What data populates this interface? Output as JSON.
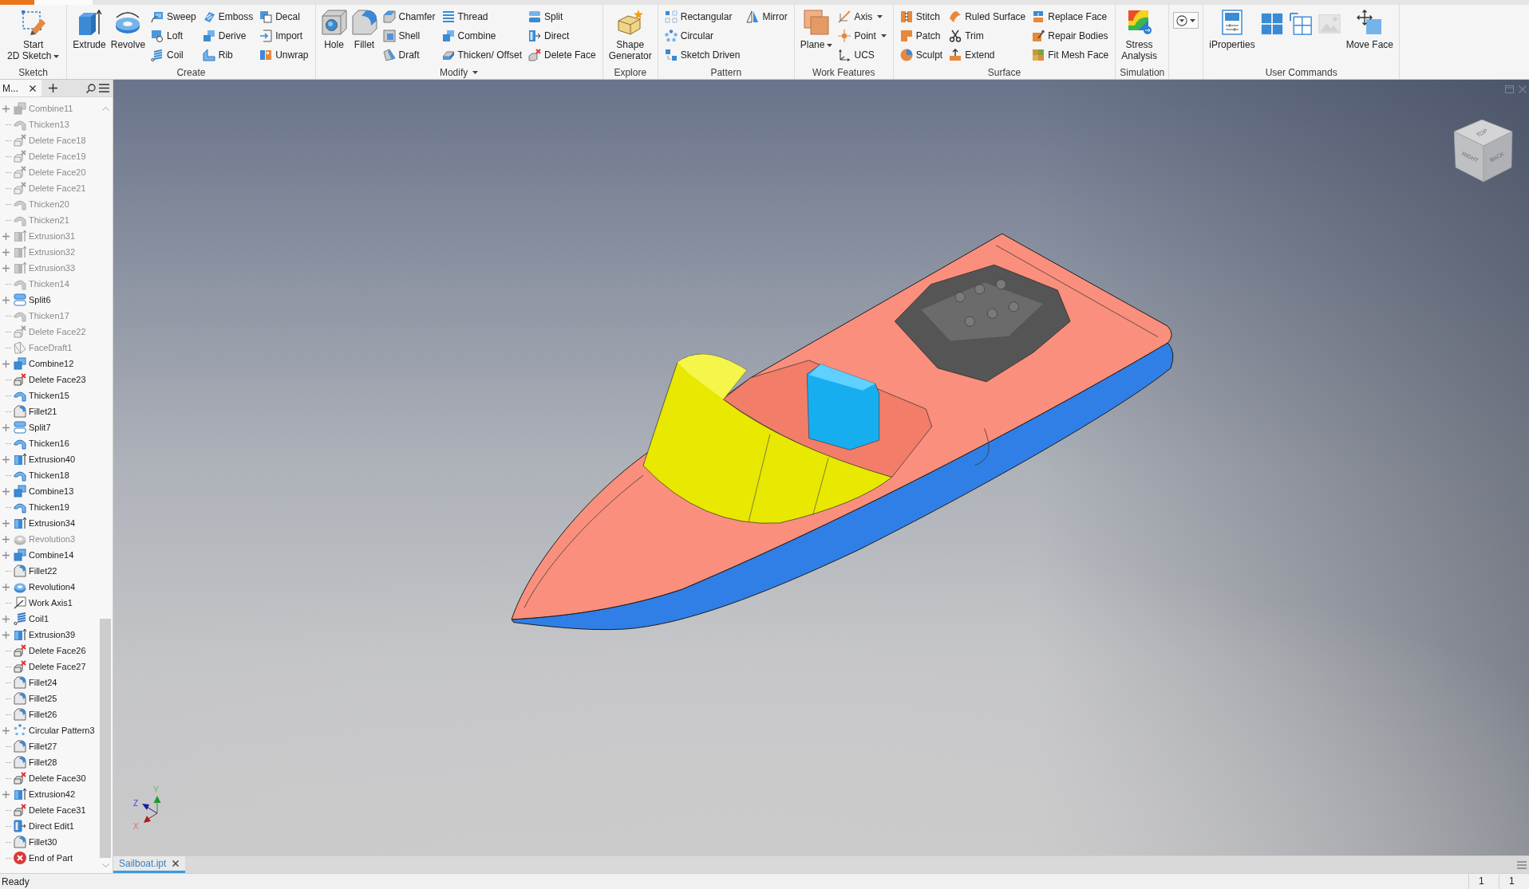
{
  "ribbon": {
    "groups": [
      {
        "label": "Sketch",
        "menu": false,
        "columns": [
          [
            {
              "label": "Start\n2D Sketch",
              "kind": "large",
              "dropdown": true
            }
          ]
        ]
      },
      {
        "label": "Create",
        "menu": false,
        "columns": [
          [
            {
              "label": "Extrude",
              "kind": "large",
              "dropdown": false
            }
          ],
          [
            {
              "label": "Revolve",
              "kind": "large",
              "dropdown": false
            }
          ],
          [
            {
              "label": "Sweep",
              "kind": "small",
              "dropdown": false
            },
            {
              "label": "Loft",
              "kind": "small",
              "dropdown": false
            },
            {
              "label": "Coil",
              "kind": "small",
              "dropdown": false
            }
          ],
          [
            {
              "label": "Emboss",
              "kind": "small",
              "dropdown": false
            },
            {
              "label": "Derive",
              "kind": "small",
              "dropdown": false
            },
            {
              "label": "Rib",
              "kind": "small",
              "dropdown": false
            }
          ],
          [
            {
              "label": "Decal",
              "kind": "small",
              "dropdown": false
            },
            {
              "label": "Import",
              "kind": "small",
              "dropdown": false
            },
            {
              "label": "Unwrap",
              "kind": "small",
              "dropdown": false
            }
          ]
        ]
      },
      {
        "label": "Modify",
        "menu": true,
        "columns": [
          [
            {
              "label": "Hole",
              "kind": "large",
              "dropdown": false
            }
          ],
          [
            {
              "label": "Fillet",
              "kind": "large",
              "dropdown": false
            }
          ],
          [
            {
              "label": "Chamfer",
              "kind": "small",
              "dropdown": false
            },
            {
              "label": "Shell",
              "kind": "small",
              "dropdown": false
            },
            {
              "label": "Draft",
              "kind": "small",
              "dropdown": false
            }
          ],
          [
            {
              "label": "Thread",
              "kind": "small",
              "dropdown": false
            },
            {
              "label": "Combine",
              "kind": "small",
              "dropdown": false
            },
            {
              "label": "Thicken/ Offset",
              "kind": "small",
              "dropdown": false
            }
          ],
          [
            {
              "label": "Split",
              "kind": "small",
              "dropdown": false
            },
            {
              "label": "Direct",
              "kind": "small",
              "dropdown": false
            },
            {
              "label": "Delete Face",
              "kind": "small",
              "dropdown": false
            }
          ]
        ]
      },
      {
        "label": "Explore",
        "menu": false,
        "columns": [
          [
            {
              "label": "Shape\nGenerator",
              "kind": "large",
              "dropdown": false
            }
          ]
        ]
      },
      {
        "label": "Pattern",
        "menu": false,
        "columns": [
          [
            {
              "label": "Rectangular",
              "kind": "small",
              "dropdown": false
            },
            {
              "label": "Circular",
              "kind": "small",
              "dropdown": false
            },
            {
              "label": "Sketch Driven",
              "kind": "small",
              "dropdown": false
            }
          ],
          [
            {
              "label": "Mirror",
              "kind": "small",
              "dropdown": false
            }
          ]
        ]
      },
      {
        "label": "Work Features",
        "menu": false,
        "columns": [
          [
            {
              "label": "Plane",
              "kind": "large",
              "dropdown": true
            }
          ],
          [
            {
              "label": "Axis",
              "kind": "small",
              "dropdown": true
            },
            {
              "label": "Point",
              "kind": "small",
              "dropdown": true
            },
            {
              "label": "UCS",
              "kind": "small",
              "dropdown": false
            }
          ]
        ]
      },
      {
        "label": "Surface",
        "menu": false,
        "columns": [
          [
            {
              "label": "Stitch",
              "kind": "small",
              "dropdown": false
            },
            {
              "label": "Patch",
              "kind": "small",
              "dropdown": false
            },
            {
              "label": "Sculpt",
              "kind": "small",
              "dropdown": false
            }
          ],
          [
            {
              "label": "Ruled Surface",
              "kind": "small",
              "dropdown": false
            },
            {
              "label": "Trim",
              "kind": "small",
              "dropdown": false
            },
            {
              "label": "Extend",
              "kind": "small",
              "dropdown": false
            }
          ],
          [
            {
              "label": "Replace Face",
              "kind": "small",
              "dropdown": false
            },
            {
              "label": "Repair Bodies",
              "kind": "small",
              "dropdown": false
            },
            {
              "label": "Fit Mesh Face",
              "kind": "small",
              "dropdown": false
            }
          ]
        ]
      },
      {
        "label": "Simulation",
        "menu": false,
        "columns": [
          [
            {
              "label": "Stress\nAnalysis",
              "kind": "large",
              "dropdown": false
            }
          ]
        ]
      },
      {
        "columns": [
          [
            {
              "kind": "menu",
              "dropdown": true
            }
          ]
        ]
      },
      {
        "label": "User Commands",
        "menu": false,
        "columns": [
          [
            {
              "label": "iProperties",
              "kind": "large",
              "dropdown": false
            }
          ],
          [
            {
              "kind": "icon",
              "dropdown": false
            }
          ],
          [
            {
              "kind": "icon",
              "dropdown": false
            }
          ],
          [
            {
              "kind": "icon",
              "dropdown": false
            }
          ],
          [
            {
              "label": "Move Face",
              "kind": "large",
              "dropdown": false
            }
          ]
        ]
      }
    ]
  },
  "browser": {
    "tab": "M...",
    "items": [
      {
        "label": "Combine11",
        "kind": "combine",
        "expandable": true,
        "dimmed": true
      },
      {
        "label": "Thicken13",
        "kind": "thicken",
        "expandable": false,
        "dimmed": true
      },
      {
        "label": "Delete Face18",
        "kind": "delete-face",
        "expandable": false,
        "dimmed": true
      },
      {
        "label": "Delete Face19",
        "kind": "delete-face",
        "expandable": false,
        "dimmed": true
      },
      {
        "label": "Delete Face20",
        "kind": "delete-face",
        "expandable": false,
        "dimmed": true
      },
      {
        "label": "Delete Face21",
        "kind": "delete-face",
        "expandable": false,
        "dimmed": true
      },
      {
        "label": "Thicken20",
        "kind": "thicken",
        "expandable": false,
        "dimmed": true
      },
      {
        "label": "Thicken21",
        "kind": "thicken",
        "expandable": false,
        "dimmed": true
      },
      {
        "label": "Extrusion31",
        "kind": "extrusion",
        "expandable": true,
        "dimmed": true
      },
      {
        "label": "Extrusion32",
        "kind": "extrusion",
        "expandable": true,
        "dimmed": true
      },
      {
        "label": "Extrusion33",
        "kind": "extrusion",
        "expandable": true,
        "dimmed": true
      },
      {
        "label": "Thicken14",
        "kind": "thicken",
        "expandable": false,
        "dimmed": true
      },
      {
        "label": "Split6",
        "kind": "split",
        "expandable": true,
        "dimmed": false
      },
      {
        "label": "Thicken17",
        "kind": "thicken",
        "expandable": false,
        "dimmed": true
      },
      {
        "label": "Delete Face22",
        "kind": "delete-face",
        "expandable": false,
        "dimmed": true
      },
      {
        "label": "FaceDraft1",
        "kind": "face-draft",
        "expandable": false,
        "dimmed": true
      },
      {
        "label": "Combine12",
        "kind": "combine",
        "expandable": true,
        "dimmed": false
      },
      {
        "label": "Delete Face23",
        "kind": "delete-face",
        "expandable": false,
        "dimmed": false
      },
      {
        "label": "Thicken15",
        "kind": "thicken",
        "expandable": false,
        "dimmed": false
      },
      {
        "label": "Fillet21",
        "kind": "fillet",
        "expandable": false,
        "dimmed": false
      },
      {
        "label": "Split7",
        "kind": "split",
        "expandable": true,
        "dimmed": false
      },
      {
        "label": "Thicken16",
        "kind": "thicken",
        "expandable": false,
        "dimmed": false
      },
      {
        "label": "Extrusion40",
        "kind": "extrusion",
        "expandable": true,
        "dimmed": false
      },
      {
        "label": "Thicken18",
        "kind": "thicken",
        "expandable": false,
        "dimmed": false
      },
      {
        "label": "Combine13",
        "kind": "combine",
        "expandable": true,
        "dimmed": false
      },
      {
        "label": "Thicken19",
        "kind": "thicken",
        "expandable": false,
        "dimmed": false
      },
      {
        "label": "Extrusion34",
        "kind": "extrusion",
        "expandable": true,
        "dimmed": false
      },
      {
        "label": "Revolution3",
        "kind": "revolution",
        "expandable": true,
        "dimmed": true
      },
      {
        "label": "Combine14",
        "kind": "combine",
        "expandable": true,
        "dimmed": false
      },
      {
        "label": "Fillet22",
        "kind": "fillet",
        "expandable": false,
        "dimmed": false
      },
      {
        "label": "Revolution4",
        "kind": "revolution",
        "expandable": true,
        "dimmed": false
      },
      {
        "label": "Work Axis1",
        "kind": "work-axis",
        "expandable": false,
        "dimmed": false
      },
      {
        "label": "Coil1",
        "kind": "coil",
        "expandable": true,
        "dimmed": false
      },
      {
        "label": "Extrusion39",
        "kind": "extrusion",
        "expandable": true,
        "dimmed": false
      },
      {
        "label": "Delete Face26",
        "kind": "delete-face",
        "expandable": false,
        "dimmed": false
      },
      {
        "label": "Delete Face27",
        "kind": "delete-face",
        "expandable": false,
        "dimmed": false
      },
      {
        "label": "Fillet24",
        "kind": "fillet",
        "expandable": false,
        "dimmed": false
      },
      {
        "label": "Fillet25",
        "kind": "fillet",
        "expandable": false,
        "dimmed": false
      },
      {
        "label": "Fillet26",
        "kind": "fillet",
        "expandable": false,
        "dimmed": false
      },
      {
        "label": "Circular Pattern3",
        "kind": "circular-pattern",
        "expandable": true,
        "dimmed": false
      },
      {
        "label": "Fillet27",
        "kind": "fillet",
        "expandable": false,
        "dimmed": false
      },
      {
        "label": "Fillet28",
        "kind": "fillet",
        "expandable": false,
        "dimmed": false
      },
      {
        "label": "Delete Face30",
        "kind": "delete-face",
        "expandable": false,
        "dimmed": false
      },
      {
        "label": "Extrusion42",
        "kind": "extrusion",
        "expandable": true,
        "dimmed": false
      },
      {
        "label": "Delete Face31",
        "kind": "delete-face",
        "expandable": false,
        "dimmed": false
      },
      {
        "label": "Direct Edit1",
        "kind": "direct-edit",
        "expandable": false,
        "dimmed": false
      },
      {
        "label": "Fillet30",
        "kind": "fillet",
        "expandable": false,
        "dimmed": false
      },
      {
        "label": "End of Part",
        "kind": "end-of-part",
        "expandable": false,
        "dimmed": false
      }
    ]
  },
  "viewport": {
    "viewcube": {
      "faces": [
        "TOP",
        "RIGHT",
        "BACK"
      ]
    },
    "triad": {
      "x": "X",
      "y": "Y",
      "z": "Z"
    }
  },
  "document_tabs": [
    {
      "label": "Sailboat.ipt",
      "selected": true
    }
  ],
  "status_bar": {
    "message": "Ready",
    "fields": [
      "1",
      "1"
    ]
  }
}
